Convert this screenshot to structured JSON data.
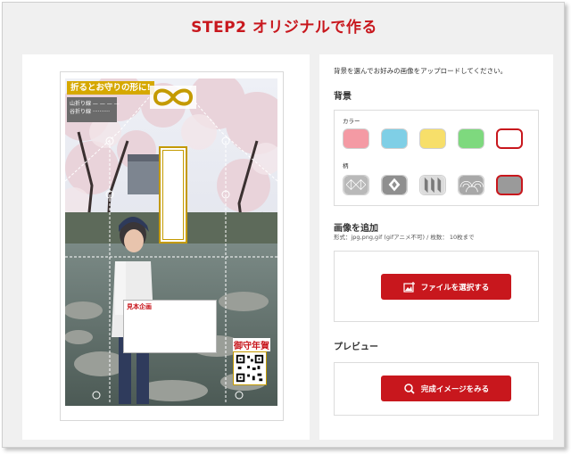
{
  "page": {
    "title": "STEP2 オリジナルで作る"
  },
  "preview_card": {
    "banner": "折るとお守りの形に!",
    "legend": [
      "山折り線 — — — —",
      "谷折り線 ··········"
    ],
    "address_label": "見本企画",
    "stamp_label": "御守年賀"
  },
  "settings": {
    "instruction": "背景を選んでお好みの画像をアップロードしてください。",
    "background": {
      "title": "背景",
      "color_label": "カラー",
      "colors": [
        {
          "name": "pink",
          "hex": "#f49aa4"
        },
        {
          "name": "blue",
          "hex": "#7fcfe6"
        },
        {
          "name": "yellow",
          "hex": "#f7df6a"
        },
        {
          "name": "green",
          "hex": "#7ed97e"
        },
        {
          "name": "white-selected",
          "hex": "#ffffff"
        }
      ],
      "pattern_label": "柄",
      "patterns": [
        "asanoha",
        "kikko",
        "yagasuri",
        "seigaiha",
        "plain-gray-selected"
      ]
    },
    "upload": {
      "title": "画像を追加",
      "note": "形式：jpg,png,gif (gifアニメ不可) / 枚数： 10枚まで",
      "button_label": "ファイルを選択する",
      "button_icon": "image-add-icon"
    },
    "preview": {
      "title": "プレビュー",
      "button_label": "完成イメージをみる",
      "button_icon": "search-icon"
    }
  },
  "colors": {
    "accent": "#c8171d",
    "gold": "#c49a00"
  }
}
